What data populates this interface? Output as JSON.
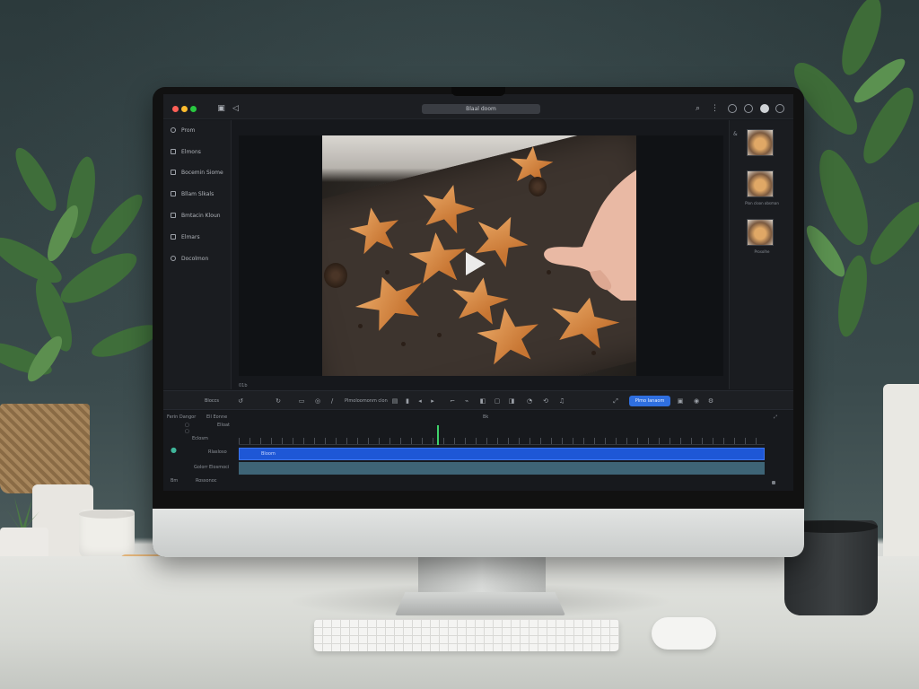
{
  "window": {
    "title": "Blaal doom"
  },
  "sidebar": {
    "items": [
      {
        "label": "Prom"
      },
      {
        "label": "Elmons"
      },
      {
        "label": "Bocemin Siome"
      },
      {
        "label": "Bllam Slkals"
      },
      {
        "label": "Bmtacin Kloun"
      },
      {
        "label": "Elmars"
      },
      {
        "label": "Docolmon"
      }
    ]
  },
  "viewer": {
    "timecode": "01b"
  },
  "toolbar": {
    "left_label": "Bloccs",
    "playback_label": "Plmoloomonm clon",
    "export_label": "Plmo Ianaom"
  },
  "timeline": {
    "tab_1": "Ferin Dangor",
    "tab_2": "Ell Eonne",
    "track_labels": [
      "Elloat",
      "Eclosm",
      "Rlasloso",
      "Golorr Elosmoci",
      "Rossonoc"
    ],
    "left_labels": [
      "Bm",
      "Bm"
    ],
    "ruler_marker": "Bk",
    "clip_label": "Bloom"
  },
  "thumbnails": {
    "items": [
      {
        "label": ""
      },
      {
        "label": "Plon cloon obsman"
      },
      {
        "label": "Prosolhe"
      }
    ],
    "marks": [
      "&"
    ]
  },
  "colors": {
    "accent": "#2f6fe0",
    "track_blue": "#1e57d6",
    "track_teal": "#3e6476",
    "playhead": "#3fd06a"
  }
}
